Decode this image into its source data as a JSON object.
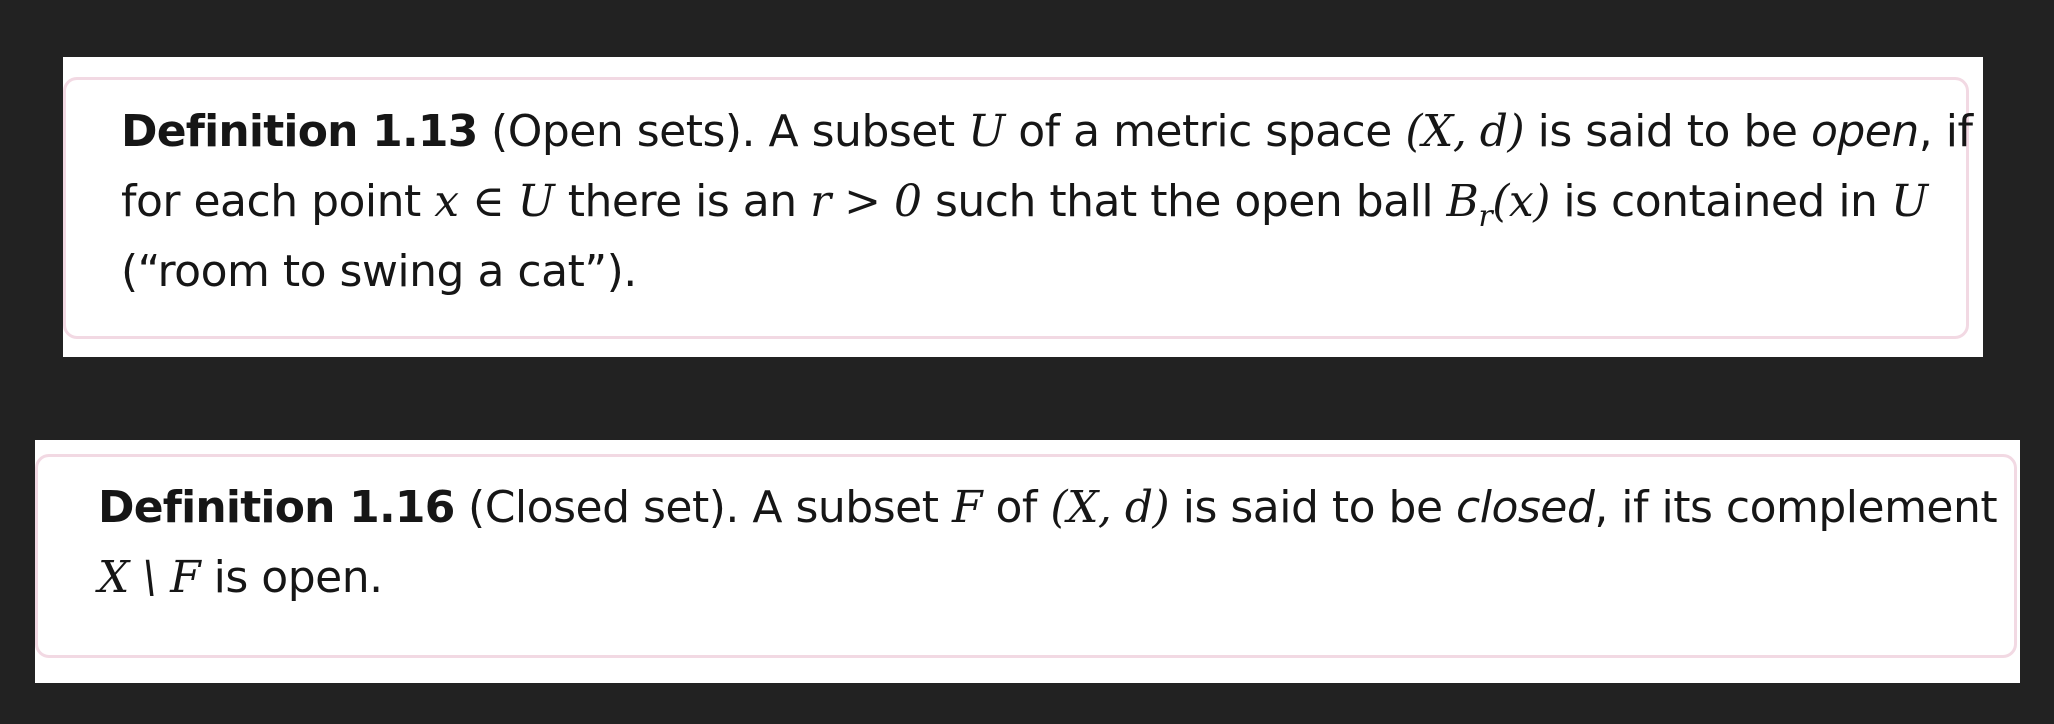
{
  "definition_1_13": {
    "label": "Definition 1.13",
    "title": "(Open sets).",
    "line1": {
      "a": "A subset",
      "U": "U",
      "b": "of a metric space",
      "space": "(X, d)",
      "c": "is said to be",
      "term": "open",
      "d": ", if"
    },
    "line2": {
      "a": "for each point",
      "x_in_U": "x ∈ U",
      "b": "there is an",
      "r_gt_0": "r > 0",
      "c": "such that the open ball",
      "B": "B",
      "r": "r",
      "bx": "(x)",
      "d": "is contained in",
      "U": "U"
    },
    "line3": "(“room to swing a cat”)."
  },
  "definition_1_16": {
    "label": "Definition 1.16",
    "title": "(Closed set).",
    "line1": {
      "a": "A subset",
      "F": "F",
      "b": "of",
      "space": "(X, d)",
      "c": "is said to be",
      "term": "closed",
      "d": ", if its complement"
    },
    "line2": {
      "expr": "X \\ F",
      "a": "is open."
    }
  }
}
